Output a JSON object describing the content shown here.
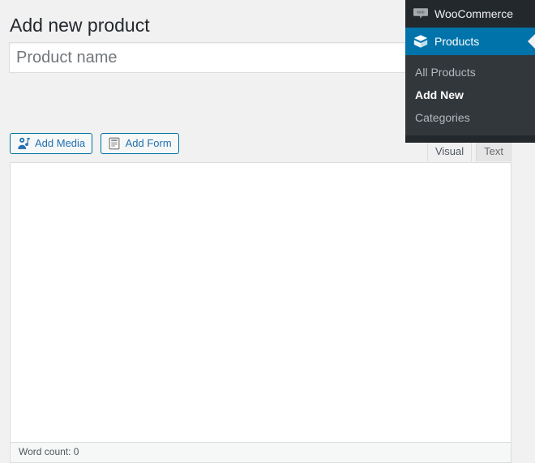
{
  "page": {
    "title": "Add new product",
    "background_color": "#f1f1f1"
  },
  "title_field": {
    "value": "",
    "placeholder": "Product name"
  },
  "editor": {
    "media_buttons": [
      {
        "label": "Add Media",
        "icon": "media-icon"
      },
      {
        "label": "Add Form",
        "icon": "form-icon"
      }
    ],
    "tabs": [
      {
        "label": "Visual",
        "active": true
      },
      {
        "label": "Text",
        "active": false
      }
    ],
    "content": "",
    "statusbar": "Word count: 0"
  },
  "admin_menu": {
    "accent_color": "#0073aa",
    "background_color": "#23282d",
    "submenu_background_color": "#32373c",
    "items": [
      {
        "label": "WooCommerce",
        "icon": "woocommerce-icon",
        "current": false
      },
      {
        "label": "Products",
        "icon": "products-box-icon",
        "current": true
      }
    ],
    "submenu": [
      {
        "label": "All Products",
        "current": false
      },
      {
        "label": "Add New",
        "current": true
      },
      {
        "label": "Categories",
        "current": false
      }
    ]
  }
}
